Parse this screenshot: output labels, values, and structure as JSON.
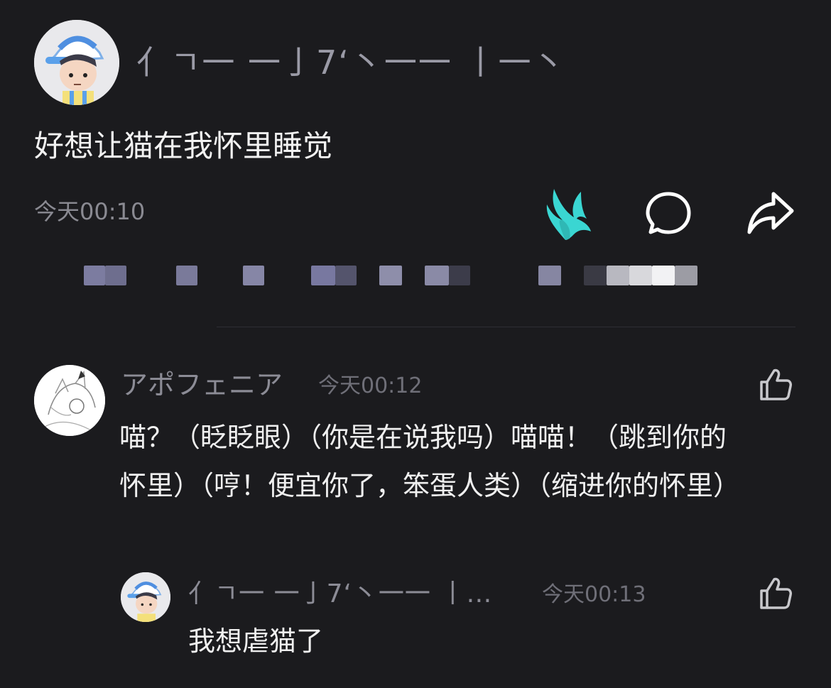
{
  "post": {
    "author_name": "亻ㄱ一 一亅7‘丶一一 丨一丶",
    "text": "好想让猫在我怀里睡觉",
    "time": "今天00:10",
    "accent_color": "#3ad6d2"
  },
  "comments": [
    {
      "author_name": "アポフェニア",
      "time": "今天00:12",
      "text": "喵？（眨眨眼）（你是在说我吗）喵喵！（跳到你的怀里）（哼！便宜你了，笨蛋人类）（缩进你的怀里）",
      "reply": {
        "author_name": "亻ㄱ一 一亅7‘丶一一 丨…",
        "time": "今天00:13",
        "text": "我想虐猫了"
      }
    }
  ]
}
